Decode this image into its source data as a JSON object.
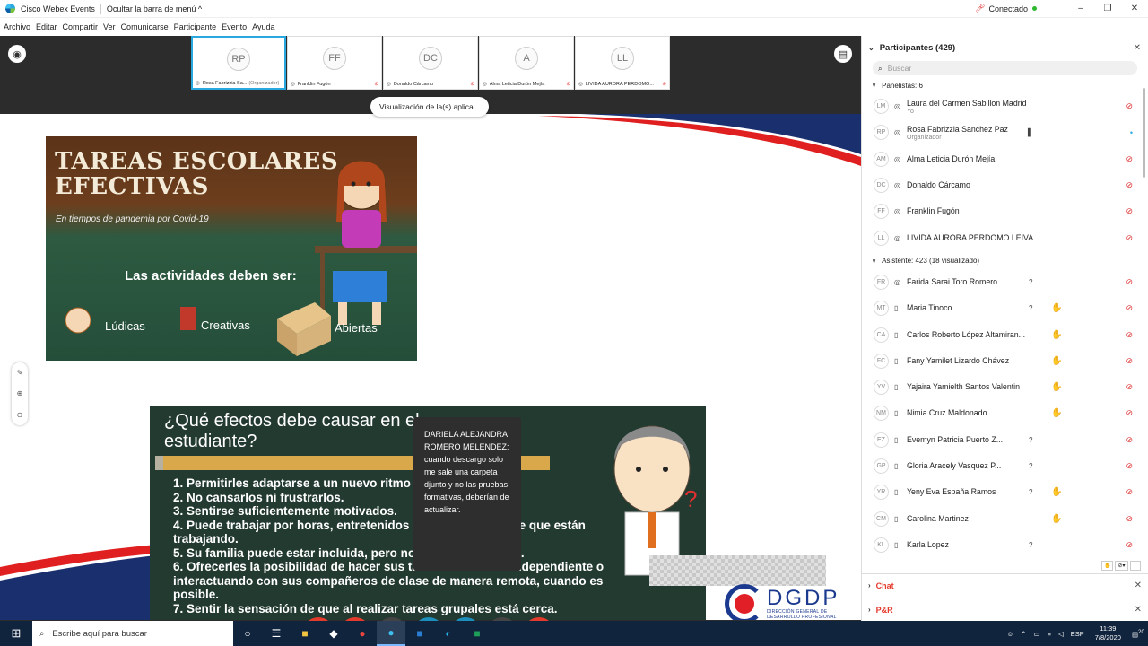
{
  "app": {
    "title": "Cisco Webex Events",
    "hide_menu": "Ocultar la barra de menú ^",
    "status": "Conectado"
  },
  "menu": [
    "Archivo",
    "Editar",
    "Compartir",
    "Ver",
    "Comunicarse",
    "Participante",
    "Evento",
    "Ayuda"
  ],
  "thumbnails": [
    {
      "initials": "RP",
      "name": "Rosa Fabrizzia Sa...",
      "role": "(Organizador)"
    },
    {
      "initials": "FF",
      "name": "Franklin Fugón"
    },
    {
      "initials": "DC",
      "name": "Donaldo Cárcamo"
    },
    {
      "initials": "A",
      "name": "Alma Leticia Durón Mejía"
    },
    {
      "initials": "LL",
      "name": "LIVIDA AURORA PERDOMO..."
    }
  ],
  "share_label": "Visualización de la(s) aplica...",
  "slide": {
    "img1": {
      "title_line1": "TAREAS ESCOLARES",
      "title_line2": "EFECTIVAS",
      "subtitle": "En tiempos de  pandemia por Covid-19",
      "lead": "Las actividades deben ser:",
      "words": [
        "Lúdicas",
        "Creativas",
        "Abiertas"
      ]
    },
    "img2": {
      "question_line1": "¿Qué efectos debe causar en el",
      "question_line2": "estudiante?",
      "items": [
        "1. Permitirles adaptarse a un nuevo ritmo de trabajo.",
        "2. No cansarlos ni frustrarlos.",
        "3. Sentirse suficientemente motivados.",
        "4. Puede trabajar por horas, entretenidos sin darse cuenta de que están trabajando.",
        "5. Su familia puede estar incluida, pero no depender de ellas.",
        "6. Ofrecerles la posibilidad de hacer sus tareas de manera independiente o interactuando con sus compañeros de clase de manera remota, cuando es posible.",
        "7. Sentir la sensación de que al realizar tareas grupales está cerca."
      ]
    },
    "logo": {
      "title": "DGDP",
      "sub1": "DIRECCIÓN GENERAL DE",
      "sub2": "DESARROLLO PROFESIONAL"
    }
  },
  "chat_popup": "DARIELA ALEJANDRA ROMERO MELENDEZ: cuando descargo solo me sale una carpeta djunto y no las pruebas formativas, deberían de actualizar.",
  "panel": {
    "title": "Participantes (429)",
    "search_placeholder": "Buscar",
    "panelists_header": "Panelistas: 6",
    "panelists": [
      {
        "initials": "LM",
        "name": "Laura del Carmen Sabillon Madrid",
        "role": "Yo"
      },
      {
        "initials": "RP",
        "name": "Rosa Fabrizzia Sanchez Paz",
        "role": "Organizador"
      },
      {
        "initials": "AM",
        "name": "Alma Leticia Durón Mejía"
      },
      {
        "initials": "DC",
        "name": "Donaldo Cárcamo"
      },
      {
        "initials": "FF",
        "name": "Franklin Fugón"
      },
      {
        "initials": "LL",
        "name": "LIVIDA AURORA PERDOMO LEIVA"
      }
    ],
    "attendees_header": "Asistente: 423 (18 visualizado)",
    "attendees": [
      {
        "initials": "FR",
        "name": "Farida Sarai Toro Romero",
        "q": "?",
        "hand": false
      },
      {
        "initials": "MT",
        "name": "Maria Tinoco",
        "q": "?",
        "hand": true
      },
      {
        "initials": "CA",
        "name": "Carlos Roberto López Altamiran...",
        "q": "",
        "hand": true
      },
      {
        "initials": "FC",
        "name": "Fany Yamilet Lizardo Chávez",
        "q": "",
        "hand": true
      },
      {
        "initials": "YV",
        "name": "Yajaira Yamielth Santos Valentin",
        "q": "",
        "hand": true
      },
      {
        "initials": "NM",
        "name": "Nimia Cruz Maldonado",
        "q": "",
        "hand": true
      },
      {
        "initials": "EZ",
        "name": "Evemyn Patricia Puerto Z...",
        "q": "?",
        "hand": false
      },
      {
        "initials": "GP",
        "name": "Gloria Aracely Vasquez P...",
        "q": "?",
        "hand": false
      },
      {
        "initials": "YR",
        "name": "Yeny Eva España Ramos",
        "q": "?",
        "hand": true
      },
      {
        "initials": "CM",
        "name": "Carolina Martinez",
        "q": "",
        "hand": true
      },
      {
        "initials": "KL",
        "name": "Karla Lopez",
        "q": "?",
        "hand": false
      }
    ],
    "chat_label": "Chat",
    "qa_label": "P&R"
  },
  "taskbar": {
    "search_placeholder": "Escribe aquí para buscar",
    "lang": "ESP",
    "time": "11:39",
    "date": "7/8/2020",
    "notif": "20"
  },
  "colors": {
    "accent": "#29a8e0",
    "danger": "#e53b2c",
    "taskbar": "#10243d"
  }
}
